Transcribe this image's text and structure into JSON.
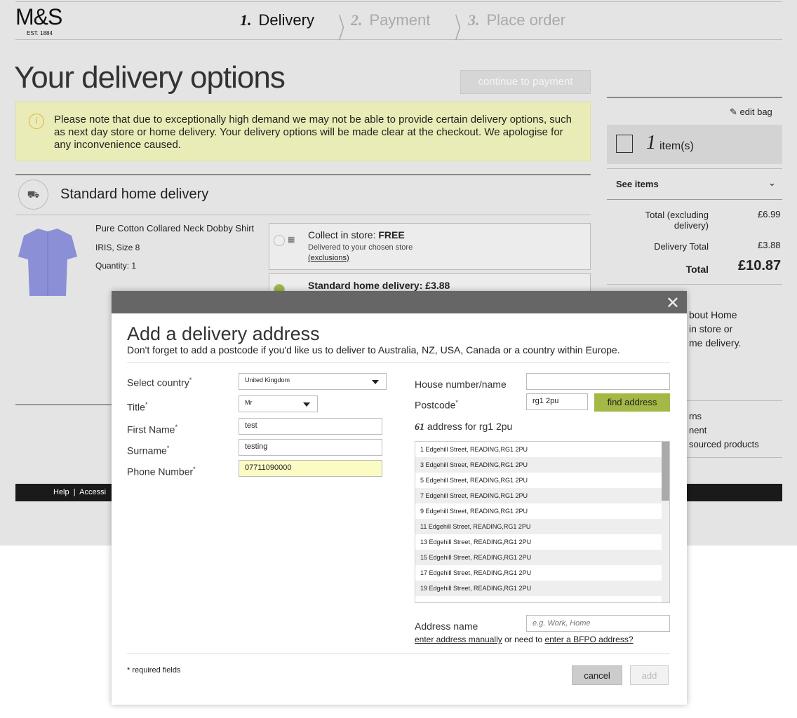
{
  "brand": {
    "logo": "M&S",
    "est": "EST. 1884"
  },
  "steps": [
    {
      "num": "1.",
      "label": "Delivery"
    },
    {
      "num": "2.",
      "label": "Payment"
    },
    {
      "num": "3.",
      "label": "Place order"
    }
  ],
  "page_title": "Your delivery options",
  "continue_label": "continue to payment",
  "notice": "Please note that due to exceptionally high demand we may not be able to provide certain delivery options, such as next day store or home delivery. Your delivery options will be made clear at the checkout. We apologise for any inconvenience caused.",
  "section_title": "Standard home delivery",
  "product": {
    "name": "Pure Cotton Collared Neck Dobby Shirt",
    "variant": "IRIS, Size 8",
    "quantity": "Quantity:  1"
  },
  "options": [
    {
      "title": "Collect in store:",
      "price": "FREE",
      "desc": "Delivered to your chosen store",
      "link": "(exclusions)"
    },
    {
      "title": "Standard home delivery:",
      "price": "£3.88"
    }
  ],
  "sidebar": {
    "edit_bag": "edit bag",
    "count": "1",
    "items_label": "item(s)",
    "see_items": "See items",
    "total_excl_label": "Total (excluding delivery)",
    "total_excl": "£6.99",
    "delivery_label": "Delivery Total",
    "delivery": "£3.88",
    "total_label": "Total",
    "total": "£10.87",
    "info": [
      "bout Home",
      "in store or",
      "me delivery."
    ],
    "links": [
      "rns",
      "nent",
      "sourced products"
    ]
  },
  "footer": {
    "help": "Help",
    "access": "Accessi"
  },
  "modal": {
    "title": "Add  a delivery address",
    "subtitle": "Don't forget to add a postcode if you'd like us to deliver to Australia, NZ, USA, Canada or a country within Europe.",
    "country_label": "Select country",
    "country": "United Kingdom",
    "title_label": "Title",
    "title_value": "Mr",
    "first_label": "First Name",
    "first": "test",
    "surname_label": "Surname",
    "surname": "testing",
    "phone_label": "Phone Number",
    "phone": "07711090000",
    "house_label": "House number/name",
    "house": "",
    "postcode_label": "Postcode",
    "postcode": "rg1 2pu",
    "find": "find address",
    "result_count": "61",
    "result_text": "address for rg1 2pu",
    "addresses": [
      "1 Edgehill Street, READING,RG1 2PU",
      "3 Edgehill Street, READING,RG1 2PU",
      "5 Edgehill Street, READING,RG1 2PU",
      "7 Edgehill Street, READING,RG1 2PU",
      "9 Edgehill Street, READING,RG1 2PU",
      "11 Edgehill Street, READING,RG1 2PU",
      "13 Edgehill Street, READING,RG1 2PU",
      "15 Edgehill Street, READING,RG1 2PU",
      "17 Edgehill Street, READING,RG1 2PU",
      "19 Edgehill Street, READING,RG1 2PU"
    ],
    "addrname_label": "Address name",
    "addrname_placeholder": "e.g. Work, Home",
    "manual": "enter address manually",
    "or_need": " or need to ",
    "bfpo": "enter a BFPO address?",
    "required": "* required fields",
    "cancel": "cancel",
    "add": "add",
    "asterisk": "*"
  }
}
